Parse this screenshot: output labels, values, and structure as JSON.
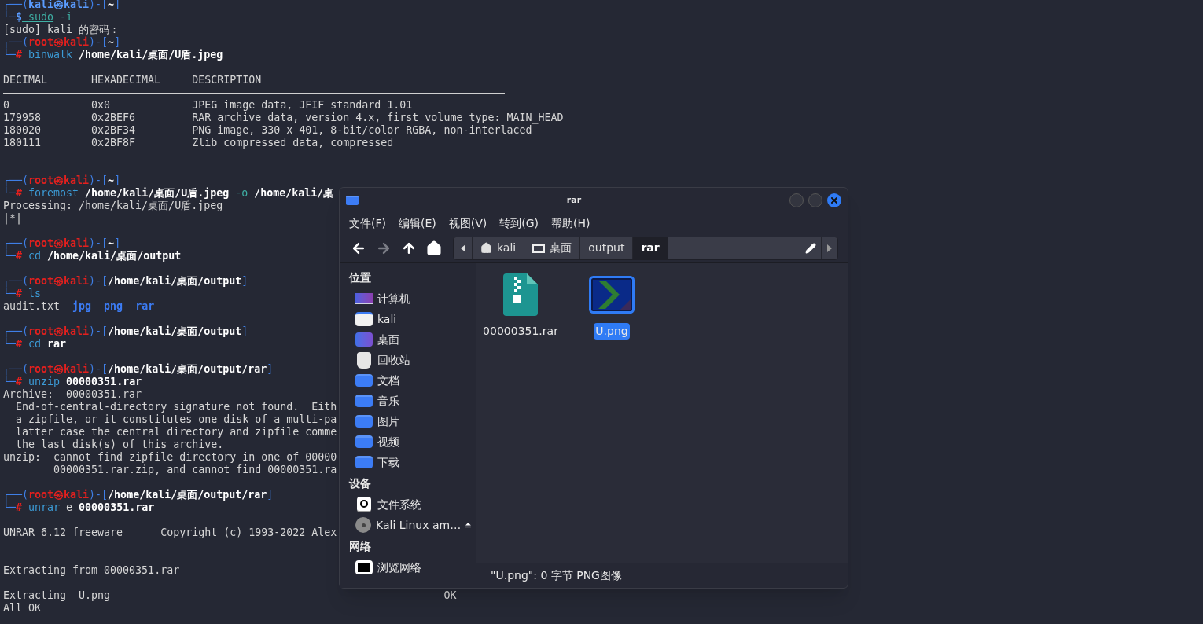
{
  "terminal": {
    "lines": [
      {
        "kind": "text",
        "segs": [
          {
            "t": "┌──(",
            "kind": "frame"
          },
          {
            "t": "kali㉿kali",
            "kind": "user"
          },
          {
            "t": ")-[",
            "kind": "frame"
          },
          {
            "t": "~",
            "kind": "path"
          },
          {
            "t": "]",
            "kind": "frame"
          }
        ]
      },
      {
        "kind": "text",
        "segs": [
          {
            "t": "└─",
            "kind": "frame"
          },
          {
            "t": "$",
            "kind": "user"
          },
          {
            "t": " sudo",
            "kind": "cmdu"
          },
          {
            "t": " -i",
            "kind": "option"
          }
        ]
      },
      {
        "kind": "text",
        "segs": [
          {
            "t": "[sudo] kali 的密码：",
            "kind": "plain"
          }
        ]
      },
      {
        "kind": "text",
        "segs": [
          {
            "t": "┌──(",
            "kind": "frame"
          },
          {
            "t": "root㉿kali",
            "kind": "root"
          },
          {
            "t": ")-[",
            "kind": "frame"
          },
          {
            "t": "~",
            "kind": "path"
          },
          {
            "t": "]",
            "kind": "frame"
          }
        ]
      },
      {
        "kind": "text",
        "segs": [
          {
            "t": "└─",
            "kind": "frame"
          },
          {
            "t": "#",
            "kind": "root"
          },
          {
            "t": " binwalk",
            "kind": "cmd"
          },
          {
            "t": " /home/kali/桌面/U盾.jpeg",
            "kind": "arg"
          }
        ]
      },
      {
        "kind": "blank"
      },
      {
        "kind": "text",
        "segs": [
          {
            "t": "DECIMAL       HEXADECIMAL     DESCRIPTION",
            "kind": "plain"
          }
        ]
      },
      {
        "kind": "rule"
      },
      {
        "kind": "text",
        "segs": [
          {
            "t": "0             0x0             JPEG image data, JFIF standard 1.01",
            "kind": "plain"
          }
        ]
      },
      {
        "kind": "text",
        "segs": [
          {
            "t": "179958        0x2BEF6         RAR archive data, version 4.x, first volume type: MAIN_HEAD",
            "kind": "plain"
          }
        ]
      },
      {
        "kind": "text",
        "segs": [
          {
            "t": "180020        0x2BF34         PNG image, 330 x 401, 8-bit/color RGBA, non-interlaced",
            "kind": "plain"
          }
        ]
      },
      {
        "kind": "text",
        "segs": [
          {
            "t": "180111        0x2BF8F         Zlib compressed data, compressed",
            "kind": "plain"
          }
        ]
      },
      {
        "kind": "blank"
      },
      {
        "kind": "blank"
      },
      {
        "kind": "text",
        "segs": [
          {
            "t": "┌──(",
            "kind": "frame"
          },
          {
            "t": "root㉿kali",
            "kind": "root"
          },
          {
            "t": ")-[",
            "kind": "frame"
          },
          {
            "t": "~",
            "kind": "path"
          },
          {
            "t": "]",
            "kind": "frame"
          }
        ]
      },
      {
        "kind": "text",
        "segs": [
          {
            "t": "└─",
            "kind": "frame"
          },
          {
            "t": "#",
            "kind": "root"
          },
          {
            "t": " foremost",
            "kind": "cmd"
          },
          {
            "t": " /home/kali/桌面/U盾.jpeg",
            "kind": "arg"
          },
          {
            "t": " -o",
            "kind": "option"
          },
          {
            "t": " /home/kali/桌",
            "kind": "arg"
          }
        ]
      },
      {
        "kind": "text",
        "segs": [
          {
            "t": "Processing: /home/kali/桌面/U盾.jpeg",
            "kind": "plain"
          }
        ]
      },
      {
        "kind": "text",
        "segs": [
          {
            "t": "|*|",
            "kind": "plain"
          }
        ]
      },
      {
        "kind": "blank"
      },
      {
        "kind": "text",
        "segs": [
          {
            "t": "┌──(",
            "kind": "frame"
          },
          {
            "t": "root㉿kali",
            "kind": "root"
          },
          {
            "t": ")-[",
            "kind": "frame"
          },
          {
            "t": "~",
            "kind": "path"
          },
          {
            "t": "]",
            "kind": "frame"
          }
        ]
      },
      {
        "kind": "text",
        "segs": [
          {
            "t": "└─",
            "kind": "frame"
          },
          {
            "t": "#",
            "kind": "root"
          },
          {
            "t": " cd",
            "kind": "cmd"
          },
          {
            "t": " /home/kali/桌面/output",
            "kind": "arg"
          }
        ]
      },
      {
        "kind": "blank"
      },
      {
        "kind": "text",
        "segs": [
          {
            "t": "┌──(",
            "kind": "frame"
          },
          {
            "t": "root㉿kali",
            "kind": "root"
          },
          {
            "t": ")-[",
            "kind": "frame"
          },
          {
            "t": "/home/kali/桌面/output",
            "kind": "path"
          },
          {
            "t": "]",
            "kind": "frame"
          }
        ]
      },
      {
        "kind": "text",
        "segs": [
          {
            "t": "└─",
            "kind": "frame"
          },
          {
            "t": "#",
            "kind": "root"
          },
          {
            "t": " ls",
            "kind": "cmd"
          }
        ]
      },
      {
        "kind": "text",
        "segs": [
          {
            "t": "audit.txt",
            "kind": "plain"
          },
          {
            "t": "  jpg",
            "kind": "dir"
          },
          {
            "t": "  png",
            "kind": "dir"
          },
          {
            "t": "  rar",
            "kind": "dir"
          }
        ]
      },
      {
        "kind": "blank"
      },
      {
        "kind": "text",
        "segs": [
          {
            "t": "┌──(",
            "kind": "frame"
          },
          {
            "t": "root㉿kali",
            "kind": "root"
          },
          {
            "t": ")-[",
            "kind": "frame"
          },
          {
            "t": "/home/kali/桌面/output",
            "kind": "path"
          },
          {
            "t": "]",
            "kind": "frame"
          }
        ]
      },
      {
        "kind": "text",
        "segs": [
          {
            "t": "└─",
            "kind": "frame"
          },
          {
            "t": "#",
            "kind": "root"
          },
          {
            "t": " cd",
            "kind": "cmd"
          },
          {
            "t": " rar",
            "kind": "arg"
          }
        ]
      },
      {
        "kind": "blank"
      },
      {
        "kind": "text",
        "segs": [
          {
            "t": "┌──(",
            "kind": "frame"
          },
          {
            "t": "root㉿kali",
            "kind": "root"
          },
          {
            "t": ")-[",
            "kind": "frame"
          },
          {
            "t": "/home/kali/桌面/output/rar",
            "kind": "path"
          },
          {
            "t": "]",
            "kind": "frame"
          }
        ]
      },
      {
        "kind": "text",
        "segs": [
          {
            "t": "└─",
            "kind": "frame"
          },
          {
            "t": "#",
            "kind": "root"
          },
          {
            "t": " unzip",
            "kind": "cmd"
          },
          {
            "t": " 00000351.rar",
            "kind": "arg"
          }
        ]
      },
      {
        "kind": "text",
        "segs": [
          {
            "t": "Archive:  00000351.rar",
            "kind": "plain"
          }
        ]
      },
      {
        "kind": "text",
        "segs": [
          {
            "t": "  End-of-central-directory signature not found.  Eith",
            "kind": "plain"
          }
        ]
      },
      {
        "kind": "text",
        "segs": [
          {
            "t": "  a zipfile, or it constitutes one disk of a multi-pa",
            "kind": "plain"
          }
        ]
      },
      {
        "kind": "text",
        "segs": [
          {
            "t": "  latter case the central directory and zipfile comme",
            "kind": "plain"
          }
        ]
      },
      {
        "kind": "text",
        "segs": [
          {
            "t": "  the last disk(s) of this archive.",
            "kind": "plain"
          }
        ]
      },
      {
        "kind": "text",
        "segs": [
          {
            "t": "unzip:  cannot find zipfile directory in one of 00000",
            "kind": "plain"
          }
        ]
      },
      {
        "kind": "text",
        "segs": [
          {
            "t": "        00000351.rar.zip, and cannot find 00000351.ra",
            "kind": "plain"
          }
        ]
      },
      {
        "kind": "blank"
      },
      {
        "kind": "text",
        "segs": [
          {
            "t": "┌──(",
            "kind": "frame"
          },
          {
            "t": "root㉿kali",
            "kind": "root"
          },
          {
            "t": ")-[",
            "kind": "frame"
          },
          {
            "t": "/home/kali/桌面/output/rar",
            "kind": "path"
          },
          {
            "t": "]",
            "kind": "frame"
          }
        ]
      },
      {
        "kind": "text",
        "segs": [
          {
            "t": "└─",
            "kind": "frame"
          },
          {
            "t": "#",
            "kind": "root"
          },
          {
            "t": " unrar",
            "kind": "cmd"
          },
          {
            "t": " e",
            "kind": "plain"
          },
          {
            "t": " 00000351.rar",
            "kind": "arg"
          }
        ]
      },
      {
        "kind": "blank"
      },
      {
        "kind": "text",
        "segs": [
          {
            "t": "UNRAR 6.12 freeware      Copyright (c) 1993-2022 Alex",
            "kind": "plain"
          }
        ]
      },
      {
        "kind": "blank"
      },
      {
        "kind": "blank"
      },
      {
        "kind": "text",
        "segs": [
          {
            "t": "Extracting from 00000351.rar",
            "kind": "plain"
          }
        ]
      },
      {
        "kind": "blank"
      },
      {
        "kind": "text",
        "segs": [
          {
            "t": "Extracting  U.png                                                     OK",
            "kind": "plain"
          }
        ]
      },
      {
        "kind": "text",
        "segs": [
          {
            "t": "All OK",
            "kind": "plain"
          }
        ]
      }
    ]
  },
  "file_manager": {
    "title": "rar",
    "menu": [
      "文件(F)",
      "编辑(E)",
      "视图(V)",
      "转到(G)",
      "帮助(H)"
    ],
    "nav": [
      {
        "kind": "back",
        "disabled": false
      },
      {
        "kind": "forward",
        "disabled": true
      },
      {
        "kind": "up",
        "disabled": false
      },
      {
        "kind": "home",
        "disabled": false
      }
    ],
    "path": [
      {
        "label": "kali",
        "kind": "home",
        "selected": false
      },
      {
        "label": "桌面",
        "kind": "desktop",
        "selected": false
      },
      {
        "label": "output",
        "kind": "plain",
        "selected": false
      },
      {
        "label": "rar",
        "kind": "plain",
        "selected": true
      }
    ],
    "sidebar": [
      {
        "heading": "位置",
        "items": [
          {
            "label": "计算机",
            "kind": "computer"
          },
          {
            "label": "kali",
            "kind": "home"
          },
          {
            "label": "桌面",
            "kind": "desktop"
          },
          {
            "label": "回收站",
            "kind": "trash"
          },
          {
            "label": "文档",
            "kind": "folder"
          },
          {
            "label": "音乐",
            "kind": "folder"
          },
          {
            "label": "图片",
            "kind": "folder"
          },
          {
            "label": "视频",
            "kind": "folder"
          },
          {
            "label": "下载",
            "kind": "folder"
          }
        ]
      },
      {
        "heading": "设备",
        "items": [
          {
            "label": "文件系统",
            "kind": "drive"
          },
          {
            "label": "Kali Linux am…",
            "kind": "disc",
            "eject": true
          }
        ]
      },
      {
        "heading": "网络",
        "items": [
          {
            "label": "浏览网络",
            "kind": "network"
          }
        ]
      }
    ],
    "files": [
      {
        "name": "00000351.rar",
        "kind": "archive",
        "selected": false
      },
      {
        "name": "U.png",
        "kind": "image",
        "selected": true
      }
    ],
    "status": "\"U.png\": 0 字节 PNG图像"
  }
}
